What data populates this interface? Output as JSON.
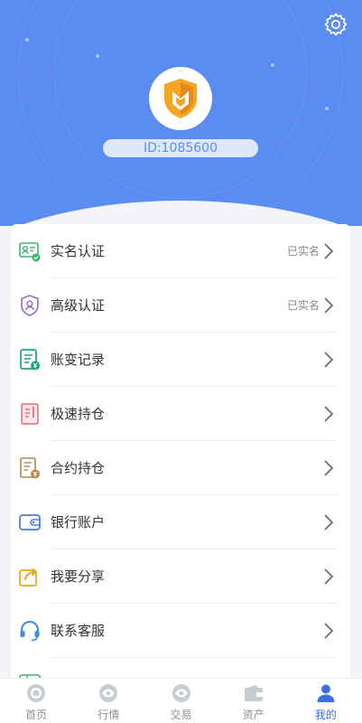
{
  "header": {
    "user_id": "ID:1085600",
    "settings_icon": "gear-icon",
    "avatar_icon": "shield-logo-icon",
    "bg_color": "#5a8cf2"
  },
  "menu": {
    "items": [
      {
        "label": "实名认证",
        "status": "已实名",
        "icon": "id-card-icon",
        "color": "#3bb56b"
      },
      {
        "label": "高级认证",
        "status": "已实名",
        "icon": "shield-user-icon",
        "color": "#8c6cd6"
      },
      {
        "label": "账变记录",
        "status": "",
        "icon": "record-yen-icon",
        "color": "#1aa384"
      },
      {
        "label": "极速持仓",
        "status": "",
        "icon": "document-icon",
        "color": "#e06b7c"
      },
      {
        "label": "合约持仓",
        "status": "",
        "icon": "contract-yen-icon",
        "color": "#b08b4f"
      },
      {
        "label": "银行账户",
        "status": "",
        "icon": "wallet-icon",
        "color": "#4f7be0"
      },
      {
        "label": "我要分享",
        "status": "",
        "icon": "share-icon",
        "color": "#e6a522"
      },
      {
        "label": "联系客服",
        "status": "",
        "icon": "headset-icon",
        "color": "#3d8be6"
      }
    ]
  },
  "tabbar": {
    "tabs": [
      {
        "label": "首页",
        "icon": "home-icon"
      },
      {
        "label": "行情",
        "icon": "market-icon"
      },
      {
        "label": "交易",
        "icon": "trade-icon"
      },
      {
        "label": "资产",
        "icon": "assets-icon"
      },
      {
        "label": "我的",
        "icon": "profile-icon",
        "active": true
      }
    ],
    "active_color": "#3b6fe6"
  }
}
